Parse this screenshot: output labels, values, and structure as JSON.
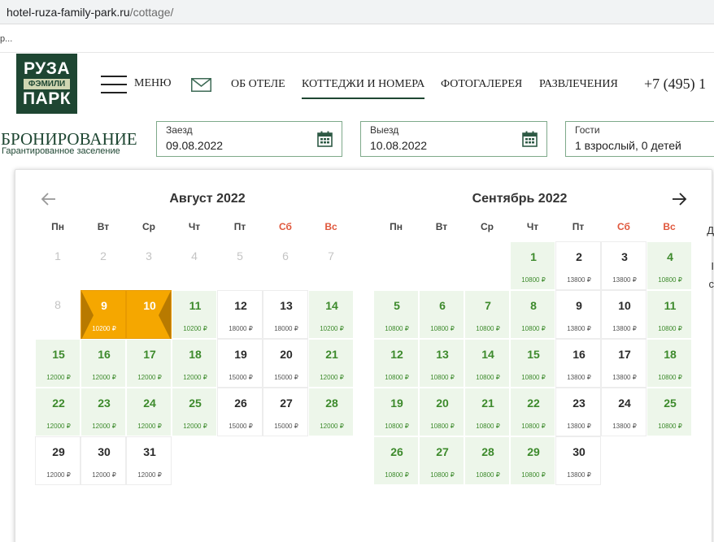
{
  "browser": {
    "url_host": "hotel-ruza-family-park.ru",
    "url_path": "/cottage/",
    "fragment": "р..."
  },
  "logo": {
    "line1": "РУЗА",
    "line2": "ФЭМИЛИ",
    "line3": "ПАРК"
  },
  "header": {
    "menu_label": "МЕНЮ",
    "nav": [
      "ОБ ОТЕЛЕ",
      "КОТТЕДЖИ И НОМЕРА",
      "ФОТОГАЛЕРЕЯ",
      "РАЗВЛЕЧЕНИЯ"
    ],
    "active_nav": "КОТТЕДЖИ И НОМЕРА",
    "phone": "+7 (495) 1"
  },
  "booking": {
    "title": "БРОНИРОВАНИЕ",
    "subtitle": "Гарантированное заселение",
    "checkin_label": "Заезд",
    "checkin_value": "09.08.2022",
    "checkout_label": "Выезд",
    "checkout_value": "10.08.2022",
    "guests_label": "Гости",
    "guests_value": "1 взрослый, 0 детей"
  },
  "colors": {
    "brand": "#1e4632",
    "available": "#3d8a2c",
    "selected": "#f5a700",
    "weekend": "#e0573c"
  },
  "icons": {
    "prev": "arrow-left-icon",
    "next": "arrow-right-icon",
    "calendar": "calendar-icon",
    "mail": "mail-icon",
    "menu": "hamburger-icon"
  },
  "weekdays": [
    "Пн",
    "Вт",
    "Ср",
    "Чт",
    "Пт",
    "Сб",
    "Вс"
  ],
  "months": [
    {
      "title": "Август 2022",
      "days": [
        {
          "d": "1",
          "s": "disabled"
        },
        {
          "d": "2",
          "s": "disabled"
        },
        {
          "d": "3",
          "s": "disabled"
        },
        {
          "d": "4",
          "s": "disabled"
        },
        {
          "d": "5",
          "s": "disabled"
        },
        {
          "d": "6",
          "s": "disabled"
        },
        {
          "d": "7",
          "s": "disabled"
        },
        {
          "d": "8",
          "s": "disabled"
        },
        {
          "d": "9",
          "p": "10200 ₽",
          "s": "sel-start"
        },
        {
          "d": "10",
          "s": "sel-end"
        },
        {
          "d": "11",
          "p": "10200 ₽",
          "s": "g"
        },
        {
          "d": "12",
          "p": "18000 ₽",
          "s": "w"
        },
        {
          "d": "13",
          "p": "18000 ₽",
          "s": "w"
        },
        {
          "d": "14",
          "p": "10200 ₽",
          "s": "g"
        },
        {
          "d": "15",
          "p": "12000 ₽",
          "s": "g"
        },
        {
          "d": "16",
          "p": "12000 ₽",
          "s": "g"
        },
        {
          "d": "17",
          "p": "12000 ₽",
          "s": "g"
        },
        {
          "d": "18",
          "p": "12000 ₽",
          "s": "g"
        },
        {
          "d": "19",
          "p": "15000 ₽",
          "s": "w"
        },
        {
          "d": "20",
          "p": "15000 ₽",
          "s": "w"
        },
        {
          "d": "21",
          "p": "12000 ₽",
          "s": "g"
        },
        {
          "d": "22",
          "p": "12000 ₽",
          "s": "g"
        },
        {
          "d": "23",
          "p": "12000 ₽",
          "s": "g"
        },
        {
          "d": "24",
          "p": "12000 ₽",
          "s": "g"
        },
        {
          "d": "25",
          "p": "12000 ₽",
          "s": "g"
        },
        {
          "d": "26",
          "p": "15000 ₽",
          "s": "w"
        },
        {
          "d": "27",
          "p": "15000 ₽",
          "s": "w"
        },
        {
          "d": "28",
          "p": "12000 ₽",
          "s": "g"
        },
        {
          "d": "29",
          "p": "12000 ₽",
          "s": "w"
        },
        {
          "d": "30",
          "p": "12000 ₽",
          "s": "w"
        },
        {
          "d": "31",
          "p": "12000 ₽",
          "s": "w"
        }
      ]
    },
    {
      "title": "Сентябрь 2022",
      "offset": 3,
      "days": [
        {
          "d": "1",
          "p": "10800 ₽",
          "s": "g"
        },
        {
          "d": "2",
          "p": "13800 ₽",
          "s": "w"
        },
        {
          "d": "3",
          "p": "13800 ₽",
          "s": "w"
        },
        {
          "d": "4",
          "p": "10800 ₽",
          "s": "g"
        },
        {
          "d": "5",
          "p": "10800 ₽",
          "s": "g"
        },
        {
          "d": "6",
          "p": "10800 ₽",
          "s": "g"
        },
        {
          "d": "7",
          "p": "10800 ₽",
          "s": "g"
        },
        {
          "d": "8",
          "p": "10800 ₽",
          "s": "g"
        },
        {
          "d": "9",
          "p": "13800 ₽",
          "s": "w"
        },
        {
          "d": "10",
          "p": "13800 ₽",
          "s": "w"
        },
        {
          "d": "11",
          "p": "10800 ₽",
          "s": "g"
        },
        {
          "d": "12",
          "p": "10800 ₽",
          "s": "g"
        },
        {
          "d": "13",
          "p": "10800 ₽",
          "s": "g"
        },
        {
          "d": "14",
          "p": "10800 ₽",
          "s": "g"
        },
        {
          "d": "15",
          "p": "10800 ₽",
          "s": "g"
        },
        {
          "d": "16",
          "p": "13800 ₽",
          "s": "w"
        },
        {
          "d": "17",
          "p": "13800 ₽",
          "s": "w"
        },
        {
          "d": "18",
          "p": "10800 ₽",
          "s": "g"
        },
        {
          "d": "19",
          "p": "10800 ₽",
          "s": "g"
        },
        {
          "d": "20",
          "p": "10800 ₽",
          "s": "g"
        },
        {
          "d": "21",
          "p": "10800 ₽",
          "s": "g"
        },
        {
          "d": "22",
          "p": "10800 ₽",
          "s": "g"
        },
        {
          "d": "23",
          "p": "13800 ₽",
          "s": "w"
        },
        {
          "d": "24",
          "p": "13800 ₽",
          "s": "w"
        },
        {
          "d": "25",
          "p": "10800 ₽",
          "s": "g"
        },
        {
          "d": "26",
          "p": "10800 ₽",
          "s": "g"
        },
        {
          "d": "27",
          "p": "10800 ₽",
          "s": "g"
        },
        {
          "d": "28",
          "p": "10800 ₽",
          "s": "g"
        },
        {
          "d": "29",
          "p": "10800 ₽",
          "s": "g"
        },
        {
          "d": "30",
          "p": "13800 ₽",
          "s": "w"
        }
      ]
    }
  ],
  "side_fragments": [
    "Д",
    "I",
    "с"
  ]
}
